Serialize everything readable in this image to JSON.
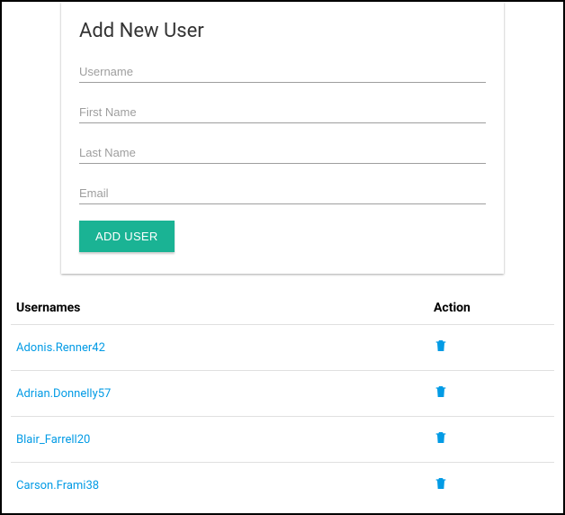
{
  "form": {
    "title": "Add New User",
    "fields": {
      "username": {
        "placeholder": "Username",
        "value": ""
      },
      "first_name": {
        "placeholder": "First Name",
        "value": ""
      },
      "last_name": {
        "placeholder": "Last Name",
        "value": ""
      },
      "email": {
        "placeholder": "Email",
        "value": ""
      }
    },
    "submit_label": "Add User"
  },
  "table": {
    "headers": {
      "usernames": "Usernames",
      "action": "Action"
    },
    "rows": [
      {
        "username": "Adonis.Renner42"
      },
      {
        "username": "Adrian.Donnelly57"
      },
      {
        "username": "Blair_Farrell20"
      },
      {
        "username": "Carson.Frami38"
      }
    ]
  },
  "icons": {
    "delete": "trash-icon"
  },
  "colors": {
    "accent": "#1ab394",
    "link": "#039be5"
  }
}
